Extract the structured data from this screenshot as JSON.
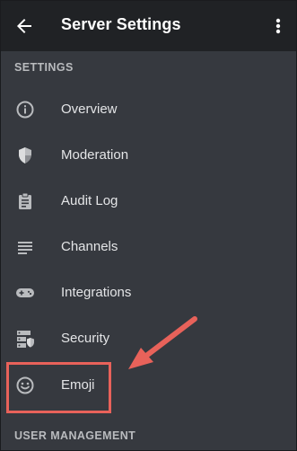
{
  "header": {
    "title": "Server Settings",
    "back_icon": "arrow-left-icon",
    "more_icon": "more-vertical-icon"
  },
  "sections": {
    "settings_label": "SETTINGS",
    "user_management_label": "USER MANAGEMENT"
  },
  "menu": {
    "items": [
      {
        "label": "Overview",
        "icon": "info-icon"
      },
      {
        "label": "Moderation",
        "icon": "shield-icon"
      },
      {
        "label": "Audit Log",
        "icon": "clipboard-icon"
      },
      {
        "label": "Channels",
        "icon": "list-lines-icon"
      },
      {
        "label": "Integrations",
        "icon": "gamepad-icon"
      },
      {
        "label": "Security",
        "icon": "security-server-icon"
      },
      {
        "label": "Emoji",
        "icon": "smiley-icon"
      }
    ]
  },
  "colors": {
    "header_bg": "#202225",
    "body_bg": "#36393f",
    "icon": "#b9bbbe",
    "annotation": "#e8625a"
  }
}
